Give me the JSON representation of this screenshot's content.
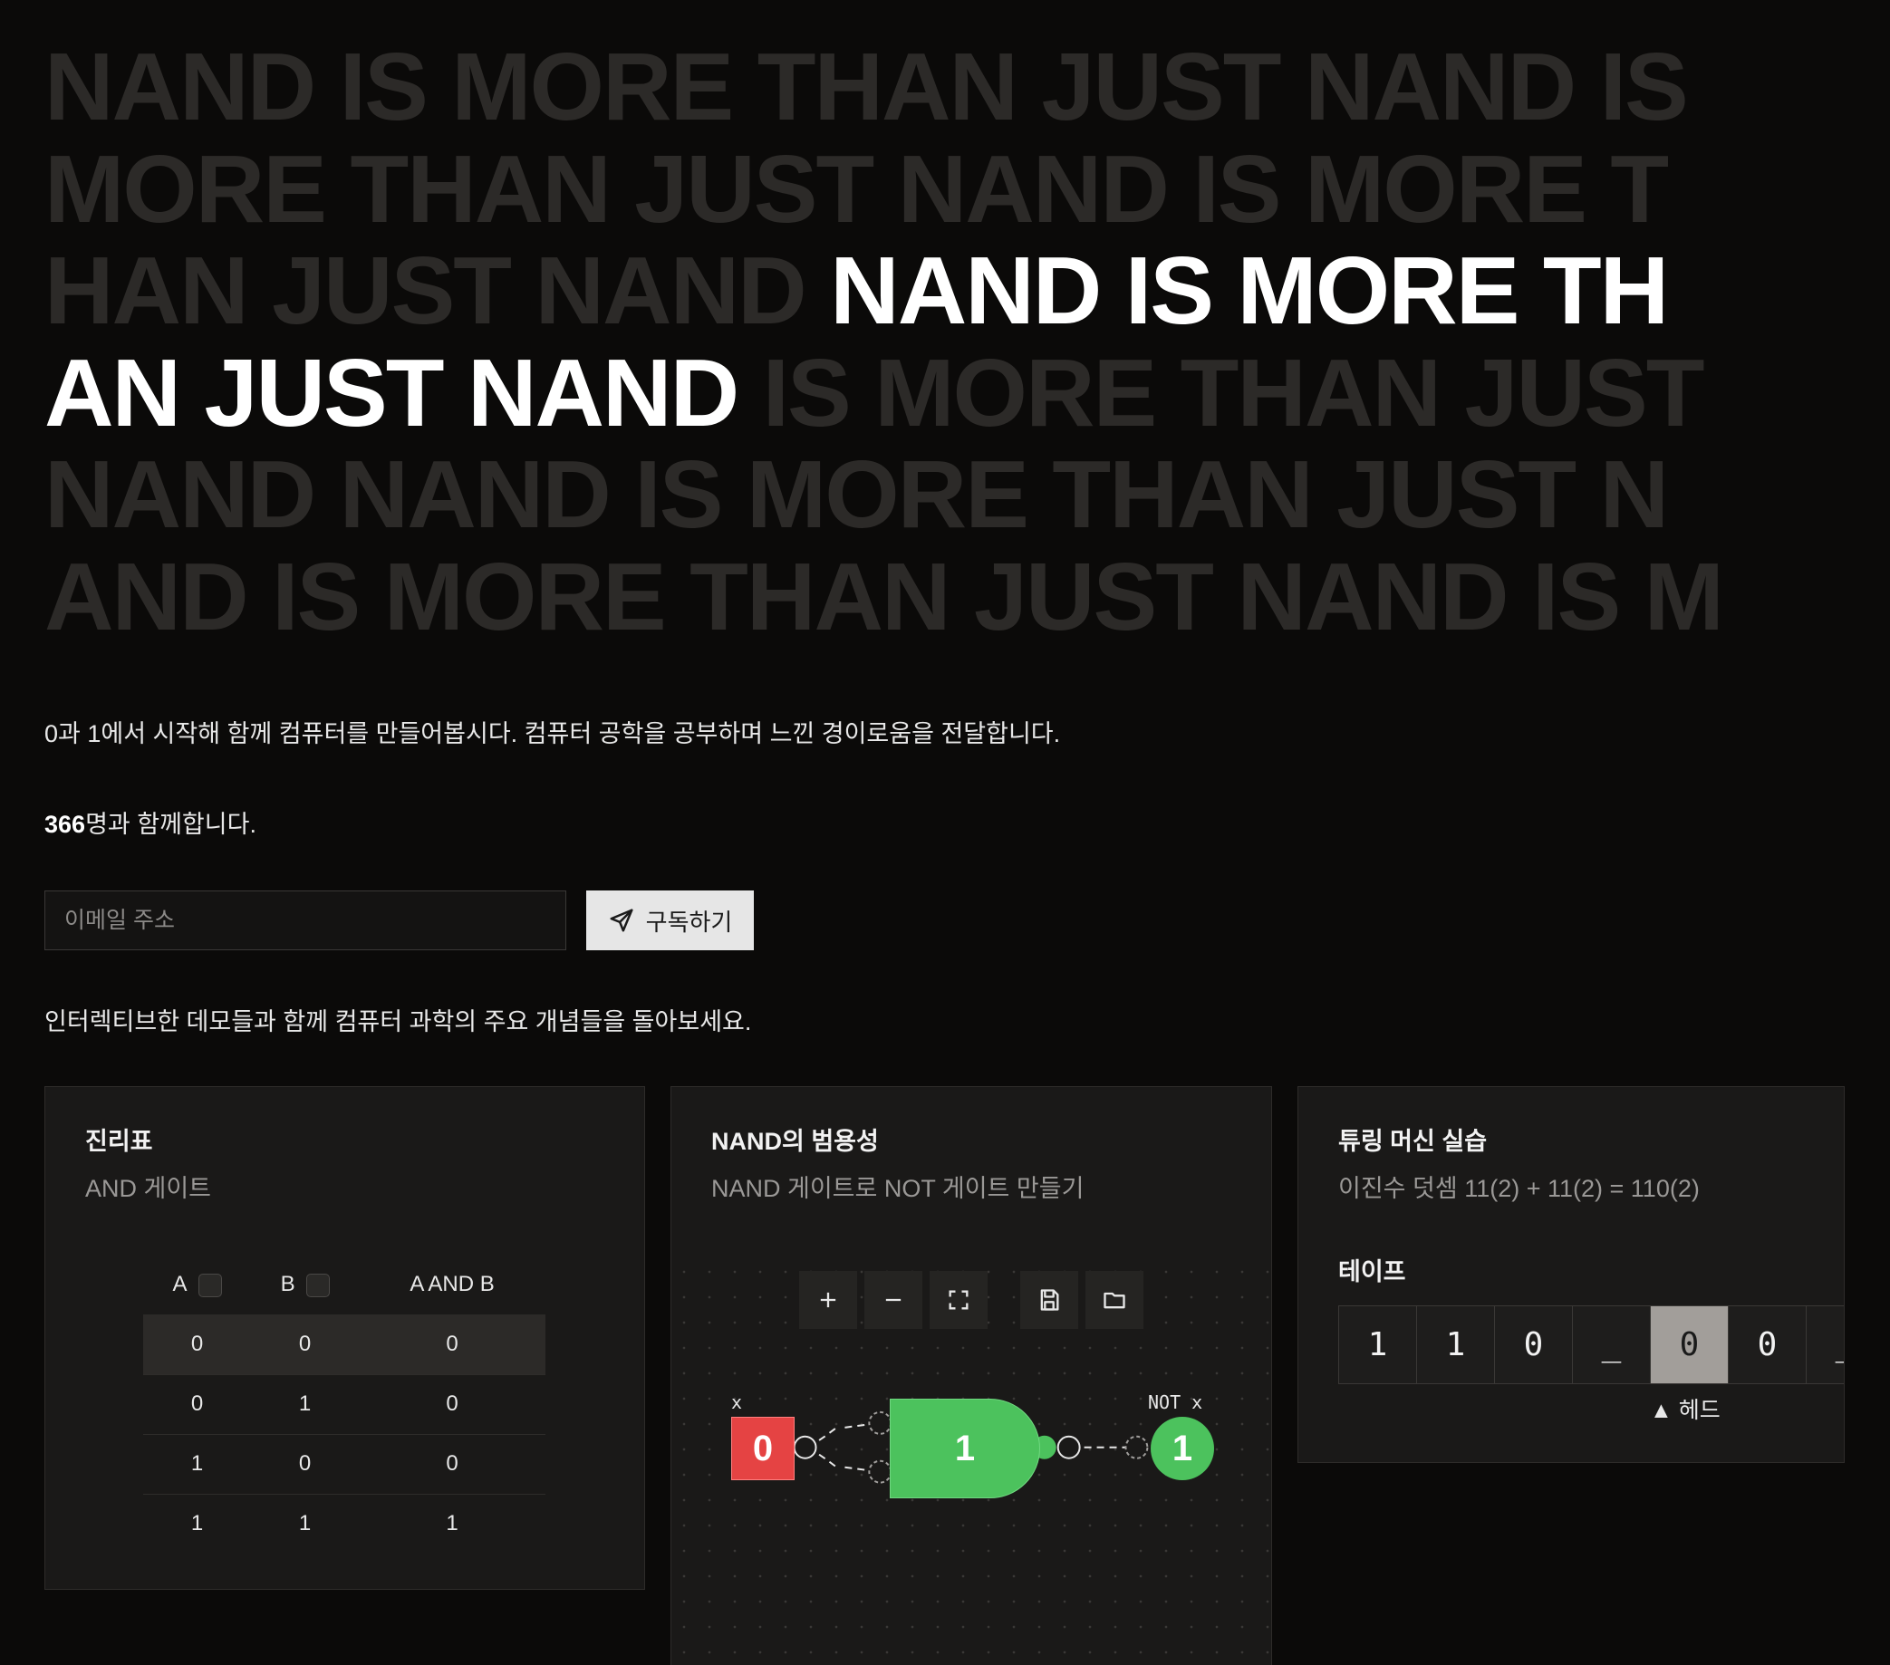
{
  "hero": {
    "lines": [
      {
        "dim": "NAND IS MORE THAN JUST NAND IS",
        "bright": "",
        "after": ""
      },
      {
        "dim": "MORE THAN JUST NAND IS MORE T",
        "bright": "",
        "after": ""
      },
      {
        "dim": "HAN JUST NAND ",
        "bright": "NAND IS MORE TH",
        "after": ""
      },
      {
        "dim": "",
        "bright": "AN JUST NAND ",
        "after": "IS MORE THAN JUST"
      },
      {
        "dim": "NAND NAND IS MORE THAN JUST N",
        "bright": "",
        "after": ""
      },
      {
        "dim": "AND IS MORE THAN JUST NAND IS M",
        "bright": "",
        "after": ""
      }
    ]
  },
  "intro": {
    "tagline": "0과 1에서 시작해 함께 컴퓨터를 만들어봅시다. 컴퓨터 공학을 공부하며 느낀 경이로움을 전달합니다.",
    "subscriber_count": "366",
    "subscriber_suffix": "명과 함께합니다.",
    "email_placeholder": "이메일 주소",
    "subscribe_label": "구독하기",
    "demo_intro": "인터렉티브한 데모들과 함께 컴퓨터 과학의 주요 개념들을 돌아보세요."
  },
  "cards": {
    "truth_table": {
      "title": "진리표",
      "subtitle": "AND 게이트",
      "headers": [
        "A",
        "B",
        "A AND B"
      ],
      "rows": [
        [
          "0",
          "0",
          "0"
        ],
        [
          "0",
          "1",
          "0"
        ],
        [
          "1",
          "0",
          "0"
        ],
        [
          "1",
          "1",
          "1"
        ]
      ]
    },
    "nand": {
      "title": "NAND의 범용성",
      "subtitle": "NAND 게이트로 NOT 게이트 만들기",
      "input_label": "x",
      "input_value": "0",
      "gate_value": "1",
      "output_label": "NOT x",
      "output_value": "1",
      "tools": [
        "plus-icon",
        "minus-icon",
        "fullscreen-icon",
        "save-icon",
        "folder-icon"
      ],
      "colors": {
        "off": "#e54343",
        "on": "#4cc25d"
      }
    },
    "turing": {
      "title": "튜링 머신 실습",
      "subtitle": "이진수 덧셈 11(2) + 11(2) = 110(2)",
      "tape_label": "테이프",
      "tape": [
        "1",
        "1",
        "0",
        "_",
        "0",
        "0",
        "_"
      ],
      "head_index": 4,
      "head_label": "▲ 헤드"
    }
  }
}
